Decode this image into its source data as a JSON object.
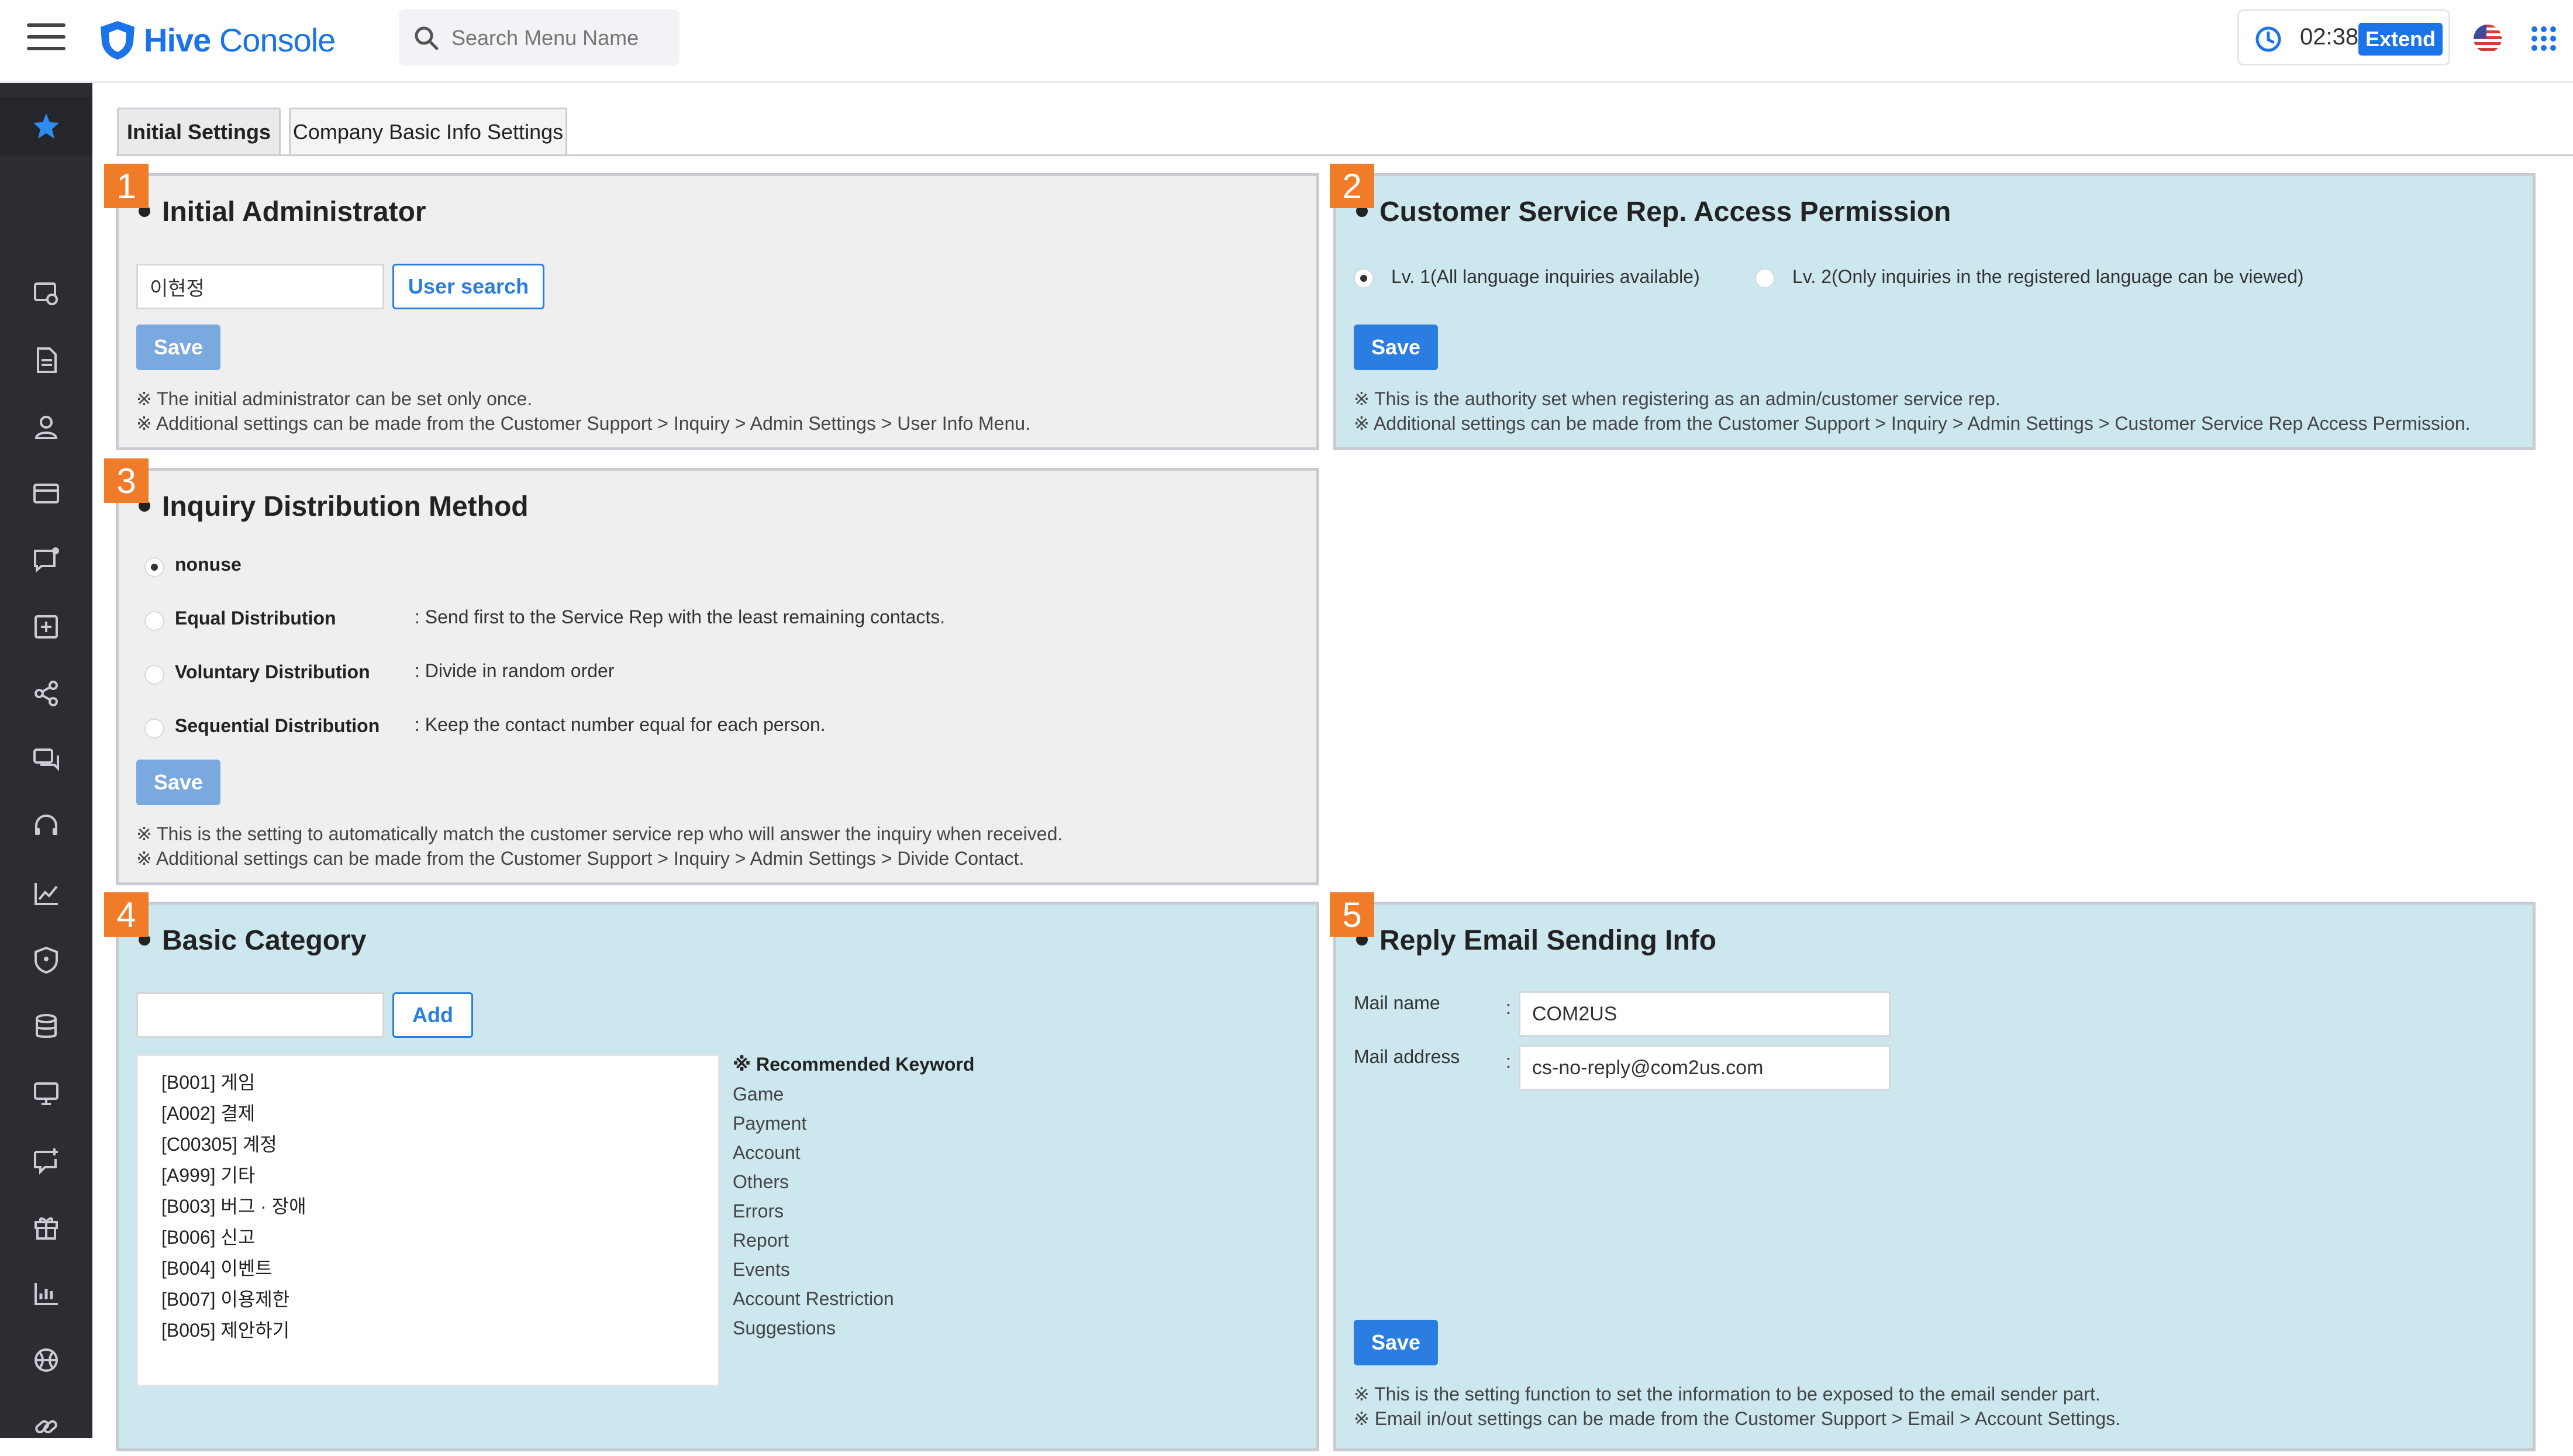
{
  "header": {
    "logo_bold": "Hive",
    "logo_light": " Console",
    "search_placeholder": "Search Menu Name",
    "timer": "02:38",
    "extend_label": "Extend"
  },
  "sidebar": {
    "items": [
      "star-icon",
      "monitor-settings-icon",
      "document-icon",
      "user-icon",
      "card-icon",
      "chat-edit-icon",
      "add-box-icon",
      "share-icon",
      "chat-bubbles-icon",
      "headset-icon",
      "chart-line-icon",
      "shield-icon",
      "database-icon",
      "screen-icon",
      "message-plus-icon",
      "gift-icon",
      "bar-chart-icon",
      "basketball-icon",
      "link-icon"
    ]
  },
  "tabs": [
    "Initial Settings",
    "Company Basic Info Settings"
  ],
  "panel1": {
    "number": "1",
    "title": "Initial Administrator",
    "admin_value": "이현정",
    "user_search": "User search",
    "save": "Save",
    "notes": [
      "※ The initial administrator can be set only once.",
      "※ Additional settings can be made from the Customer Support > Inquiry > Admin Settings > User Info Menu."
    ]
  },
  "panel2": {
    "number": "2",
    "title": "Customer Service Rep. Access Permission",
    "option1": "Lv. 1(All language inquiries available)",
    "option2": "Lv. 2(Only inquiries in the registered language can be viewed)",
    "selected": "Lv. 1",
    "save": "Save",
    "notes": [
      "※ This is the authority set when registering as an admin/customer service rep.",
      "※ Additional settings can be made from the Customer Support > Inquiry > Admin Settings > Customer Service Rep Access Permission."
    ]
  },
  "panel3": {
    "number": "3",
    "title": "Inquiry Distribution Method",
    "options": [
      {
        "label": "nonuse",
        "desc": ""
      },
      {
        "label": "Equal Distribution",
        "desc": ": Send first to the Service Rep with the least remaining contacts."
      },
      {
        "label": "Voluntary Distribution",
        "desc": ": Divide in random order"
      },
      {
        "label": "Sequential Distribution",
        "desc": ": Keep the contact number equal for each person."
      }
    ],
    "selected": "nonuse",
    "save": "Save",
    "notes": [
      "※ This is the setting to automatically match the customer service rep who will answer the inquiry when received.",
      "※ Additional settings can be made from the Customer Support > Inquiry > Admin Settings > Divide Contact."
    ]
  },
  "panel4": {
    "number": "4",
    "title": "Basic Category",
    "add": "Add",
    "categories": [
      "[B001] 게임",
      "[A002] 결제",
      "[C00305] 계정",
      "[A999] 기타",
      "[B003] 버그 · 장애",
      "[B006] 신고",
      "[B004] 이벤트",
      "[B007] 이용제한",
      "[B005] 제안하기"
    ],
    "keyword_title": "※ Recommended Keyword",
    "keywords": [
      "Game",
      "Payment",
      "Account",
      "Others",
      "Errors",
      "Report",
      "Events",
      "Account Restriction",
      "Suggestions"
    ]
  },
  "panel5": {
    "number": "5",
    "title": "Reply Email Sending Info",
    "mail_name_label": "Mail name",
    "mail_address_label": "Mail address",
    "colon": ":",
    "mail_name": "COM2US",
    "mail_address": "cs-no-reply@com2us.com",
    "save": "Save",
    "notes": [
      "※ This is the setting function to set the information to be exposed to the email sender part.",
      "※ Email in/out settings can be made from the Customer Support > Email > Account Settings."
    ]
  },
  "colors": {
    "accent": "#1a73e8",
    "badge": "#f07b28",
    "panel_blue": "#cce7ee",
    "panel_gray": "#efefef",
    "sidebar": "#2b2d33"
  }
}
